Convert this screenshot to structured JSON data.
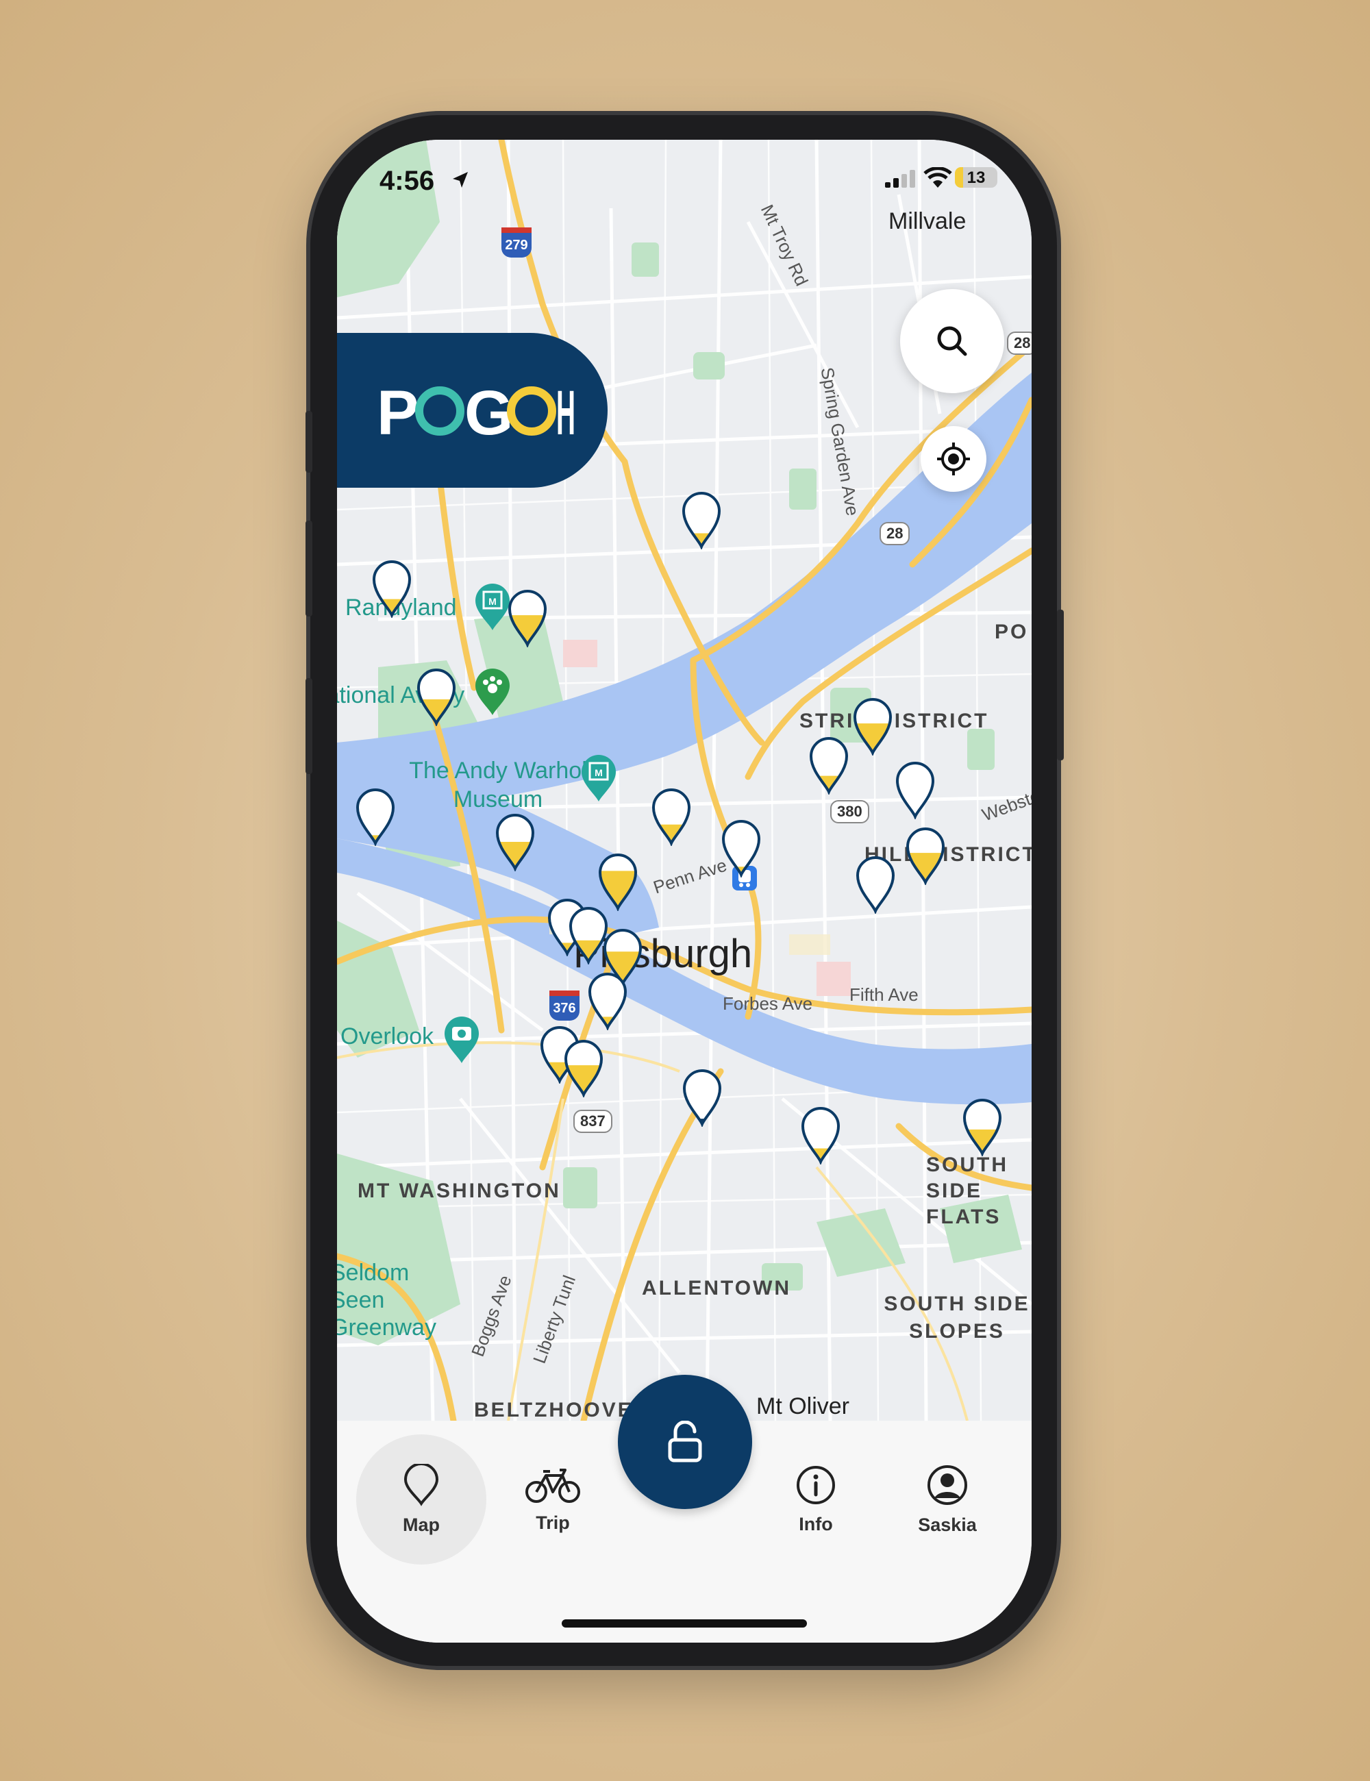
{
  "status_bar": {
    "time": "4:56",
    "battery": "13"
  },
  "brand": {
    "name": "POGOH",
    "accent_yellow": "#f4cc3a",
    "accent_teal": "#3fbfae",
    "navy": "#0c3b66"
  },
  "map": {
    "city": "Pittsburgh",
    "districts": [
      "STRIP DISTRICT",
      "HILL DISTRICT",
      "MT WASHINGTON",
      "ALLENTOWN",
      "SOUTH SIDE SLOPES",
      "SOUTH SIDE FLATS",
      "BELTZHOOVER",
      "PO"
    ],
    "towns": [
      "Millvale",
      "Mt Oliver"
    ],
    "pois": [
      "Randyland",
      "The Andy Warhol Museum",
      "National Aviary",
      "Overlook",
      "Seldom Seen Greenway"
    ],
    "streets": [
      "Mt Troy Rd",
      "Spring Garden Ave",
      "Penn Ave",
      "Forbes Ave",
      "Fifth Ave",
      "Boggs Ave",
      "Liberty Tunl",
      "Webster"
    ],
    "route_shields": [
      "279",
      "28",
      "28",
      "380",
      "376",
      "837"
    ],
    "station_fill_levels": [
      0.3,
      0.55,
      0.45,
      0.15,
      0.5,
      0.25,
      0.55,
      0.3,
      0.0,
      0.05,
      0.2,
      0.4,
      0.7,
      0.15,
      0.55,
      0.6,
      0.2,
      0.35,
      0.55,
      0.1,
      0.25,
      0.45,
      0.35
    ]
  },
  "controls": {
    "search": "search-icon",
    "locate": "locate-icon"
  },
  "nav": {
    "items": [
      {
        "label": "Map",
        "icon": "map-pin-icon"
      },
      {
        "label": "Trip",
        "icon": "bike-icon"
      },
      {
        "label": "Info",
        "icon": "info-icon"
      },
      {
        "label": "Saskia",
        "icon": "profile-icon"
      }
    ],
    "center_action": "unlock-icon"
  }
}
